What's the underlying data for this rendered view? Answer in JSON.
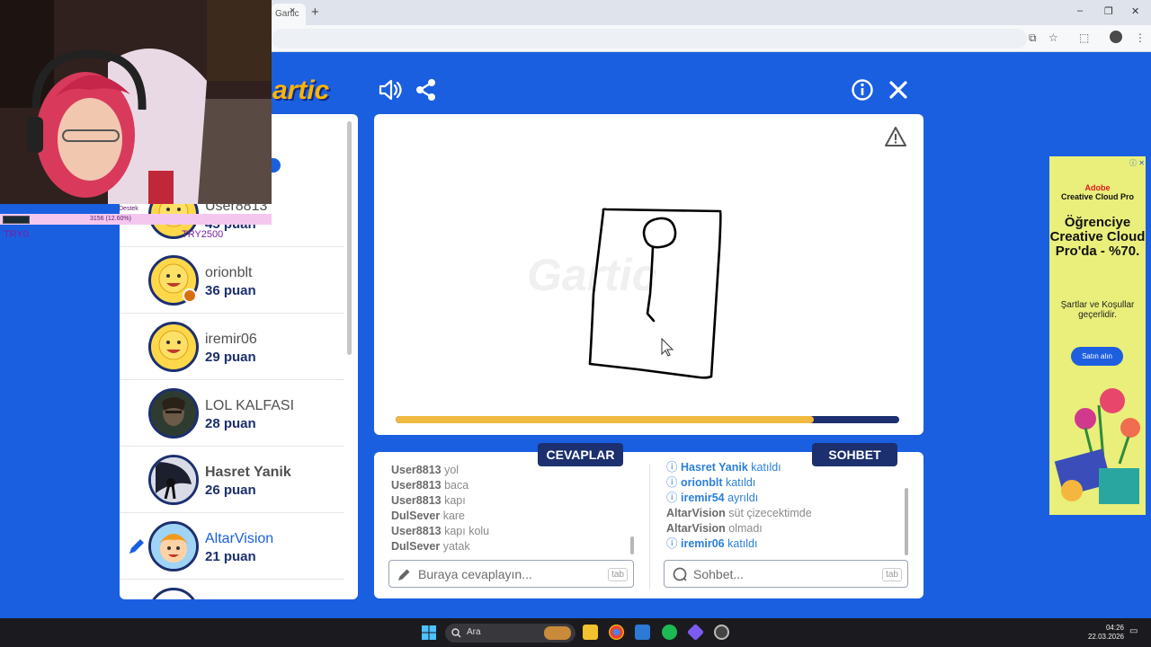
{
  "browser": {
    "tab_title": "Gartic",
    "tab_close": "×",
    "new_tab": "+",
    "minimize": "‒",
    "restore": "❐",
    "close": "✕"
  },
  "header": {
    "logo": "artic"
  },
  "players": [
    {
      "name": "User8813",
      "score": "45 puan",
      "avatar": "smiley"
    },
    {
      "name": "orionblt",
      "score": "36 puan",
      "avatar": "smiley"
    },
    {
      "name": "iremir06",
      "score": "29 puan",
      "avatar": "smiley"
    },
    {
      "name": "LOL KALFASI",
      "score": "28 puan",
      "avatar": "photo"
    },
    {
      "name": "Hasret Yanik",
      "score": "26 puan",
      "avatar": "photo-dark"
    },
    {
      "name": "AltarVision",
      "score": "21 puan",
      "avatar": "kid",
      "drawing": true
    }
  ],
  "canvas": {
    "watermark": "Gartic",
    "timer_remaining_fraction": 0.83
  },
  "tabs": {
    "answers": "CEVAPLAR",
    "chat": "SOHBET"
  },
  "answers": [
    {
      "user": "User8813",
      "text": "yol"
    },
    {
      "user": "User8813",
      "text": "baca"
    },
    {
      "user": "User8813",
      "text": "kapı"
    },
    {
      "user": "DulSever",
      "text": "kare"
    },
    {
      "user": "User8813",
      "text": "kapı kolu"
    },
    {
      "user": "DulSever",
      "text": "yatak"
    }
  ],
  "chat": [
    {
      "type": "system",
      "user": "Hasret Yanik",
      "text": "katıldı"
    },
    {
      "type": "system",
      "user": "orionblt",
      "text": "katıldı"
    },
    {
      "type": "system",
      "user": "iremir54",
      "text": "ayrıldı"
    },
    {
      "type": "message",
      "user": "AltarVision",
      "text": "süt çizecektimde"
    },
    {
      "type": "message",
      "user": "AltarVision",
      "text": "olmadı"
    },
    {
      "type": "system",
      "user": "iremir06",
      "text": "katıldı"
    }
  ],
  "inputs": {
    "answer_placeholder": "Buraya cevaplayın...",
    "chat_placeholder": "Sohbet...",
    "tab_hint": "tab"
  },
  "ad": {
    "brand_line1": "Adobe",
    "brand_line2": "Creative Cloud Pro",
    "headline": "Öğrenciye Creative Cloud Pro'da - %70.",
    "sub": "Şartlar ve Koşullar geçerlidir.",
    "cta": "Satın alın"
  },
  "overlay": {
    "donate_label": "Destek",
    "donate_progress": "3156 (12.60%)",
    "try_left": "TRY0",
    "try_right": "TRY2500"
  },
  "taskbar": {
    "search": "Ara",
    "time": "04:26",
    "date": "22.03.2026"
  },
  "colors": {
    "background": "#1a5fe0",
    "navy": "#1c2f6e",
    "timer": "#f0b940",
    "logo": "#ffb400"
  }
}
